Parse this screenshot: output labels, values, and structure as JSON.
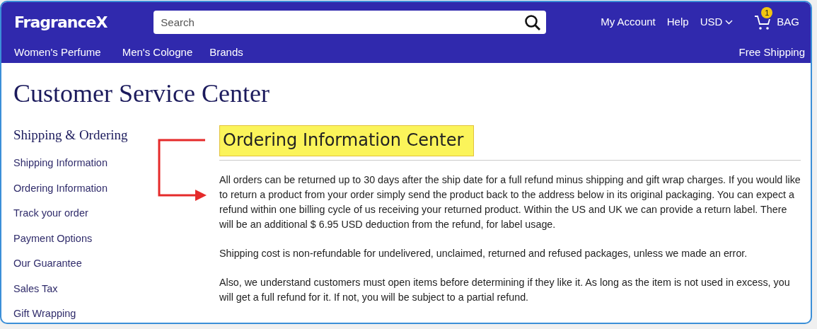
{
  "header": {
    "logo": "FragranceX",
    "search": {
      "placeholder": "Search"
    },
    "links": [
      "My Account",
      "Help"
    ],
    "currency": "USD",
    "cart": {
      "count": "1",
      "label": "BAG"
    }
  },
  "nav": {
    "items": [
      "Women's Perfume",
      "Men's Cologne",
      "Brands"
    ],
    "promo": "Free Shipping"
  },
  "page_title": "Customer Service Center",
  "sidebar": {
    "heading": "Shipping & Ordering",
    "items": [
      "Shipping Information",
      "Ordering Information",
      "Track your order",
      "Payment Options",
      "Our Guarantee",
      "Sales Tax",
      "Gift Wrapping"
    ]
  },
  "content": {
    "heading": "Ordering Information Center",
    "highlighted": true,
    "paragraphs": [
      "All orders can be returned up to 30 days after the ship date for a full refund minus shipping and gift wrap charges. If you would like to return a product from your order simply send the product back to the address below in its original packaging. You can expect a refund within one billing cycle of us receiving your returned product. Within the US and UK we can provide a return label. There will be an additional $ 6.95 USD deduction from the refund, for label usage.",
      "Shipping cost is non-refundable for undelivered, unclaimed, returned and refused packages, unless we made an error.",
      "Also, we understand customers must open items before determining if they like it. As long as the item is not used in excess, you will get a full refund for it. If not, you will be subject to a partial refund."
    ]
  }
}
